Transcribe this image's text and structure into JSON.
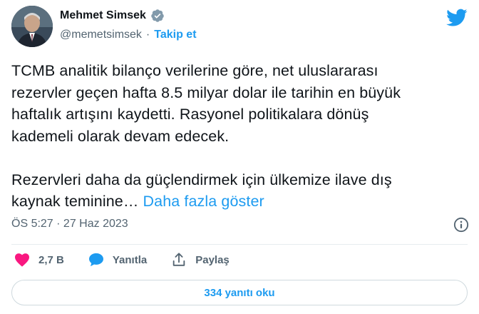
{
  "author": {
    "name": "Mehmet Simsek",
    "handle": "@memetsimsek",
    "separator": "·",
    "follow_label": "Takip et"
  },
  "tweet": {
    "paragraph1": "TCMB analitik bilanço verilerine göre, net uluslararası\nrezervler geçen hafta 8.5 milyar dolar ile tarihin en büyük\nhaftalık artışını kaydetti. Rasyonel politikalara dönüş\nkademeli olarak devam edecek.",
    "paragraph2": "Rezervleri daha da güçlendirmek için ülkemize ilave dış\nkaynak teminine… ",
    "show_more": "Daha fazla göster",
    "timestamp": "ÖS 5:27 · 27 Haz 2023"
  },
  "actions": {
    "like_count": "2,7 B",
    "reply_label": "Yanıtla",
    "share_label": "Paylaş"
  },
  "footer": {
    "read_replies_label": "334 yanıtı oku"
  },
  "colors": {
    "accent": "#1d9bf0",
    "like": "#f91880",
    "muted": "#536471"
  }
}
